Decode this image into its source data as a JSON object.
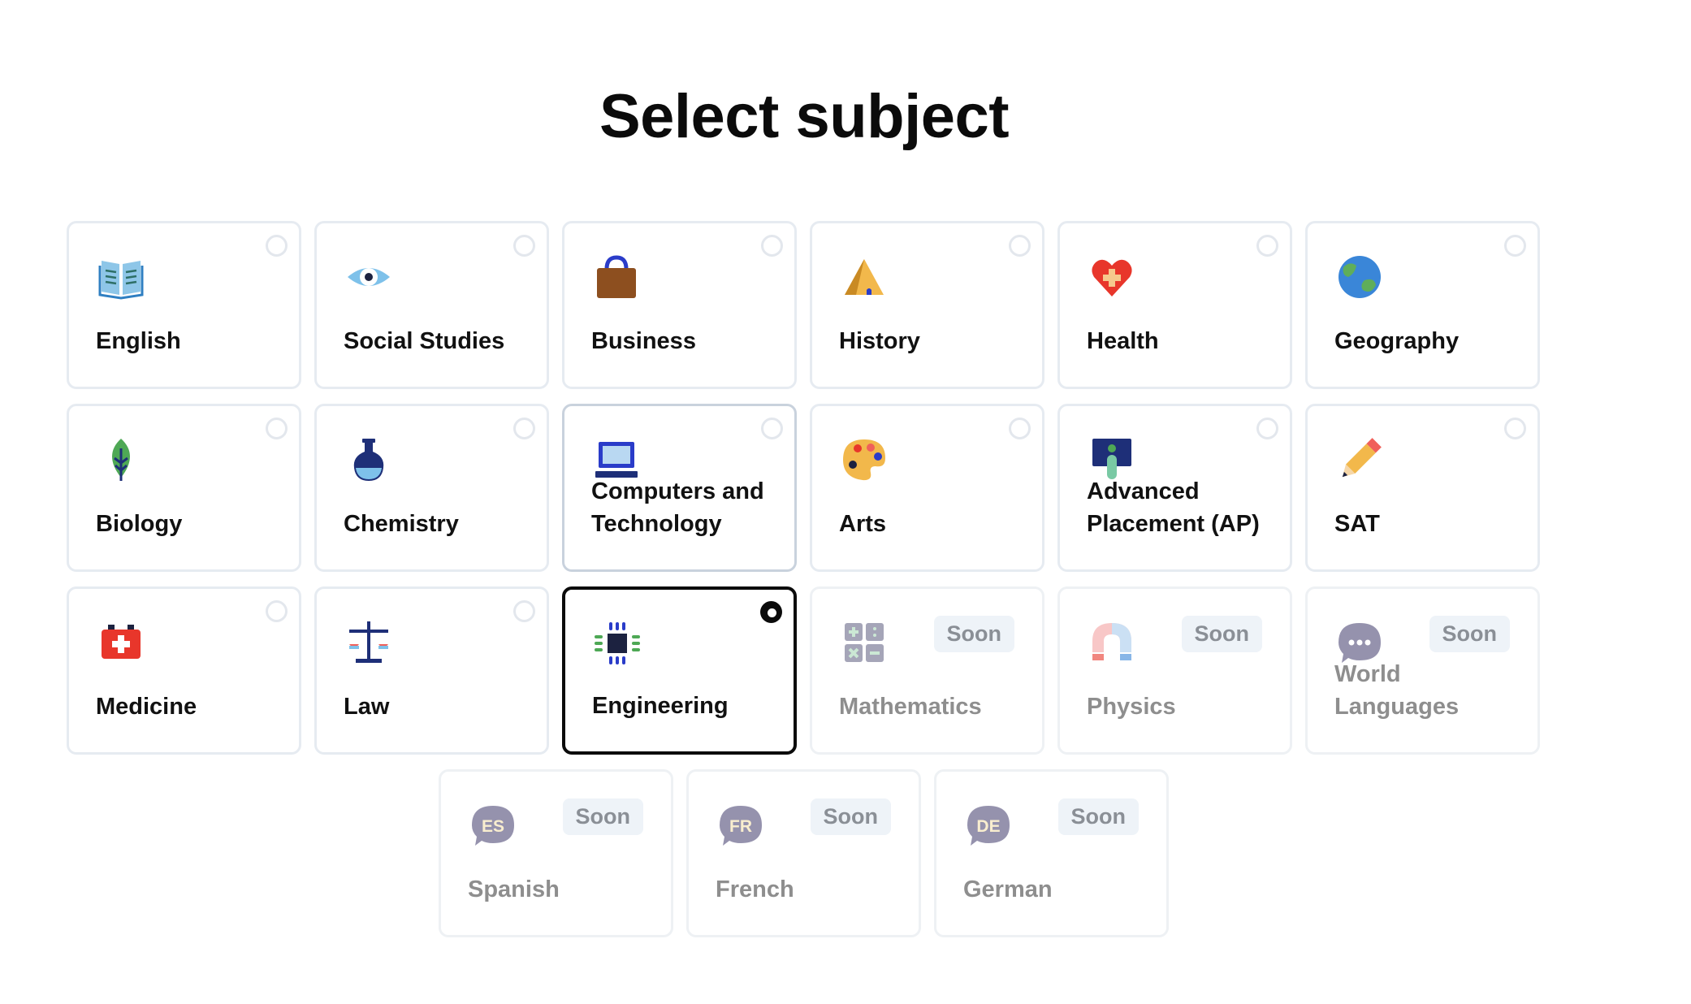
{
  "page": {
    "title": "Select subject"
  },
  "subjects": [
    {
      "label": "English",
      "icon": "open-book-icon"
    },
    {
      "label": "Social Studies",
      "icon": "eye-icon"
    },
    {
      "label": "Business",
      "icon": "briefcase-icon"
    },
    {
      "label": "History",
      "icon": "pyramid-icon"
    },
    {
      "label": "Health",
      "icon": "heart-plus-icon"
    },
    {
      "label": "Geography",
      "icon": "globe-icon"
    },
    {
      "label": "Biology",
      "icon": "leaf-icon"
    },
    {
      "label": "Chemistry",
      "icon": "flask-icon"
    },
    {
      "label": "Computers and Technology",
      "icon": "laptop-icon"
    },
    {
      "label": "Arts",
      "icon": "palette-icon"
    },
    {
      "label": "Advanced Placement (AP)",
      "icon": "ap-board-icon"
    },
    {
      "label": "SAT",
      "icon": "pencil-icon"
    },
    {
      "label": "Medicine",
      "icon": "medical-kit-icon"
    },
    {
      "label": "Law",
      "icon": "scales-icon"
    },
    {
      "label": "Engineering",
      "icon": "microchip-icon",
      "selected": true
    },
    {
      "label": "Mathematics",
      "icon": "calculator-icon",
      "badge": "Soon"
    },
    {
      "label": "Physics",
      "icon": "magnet-icon",
      "badge": "Soon"
    },
    {
      "label": "World Languages",
      "icon": "speech-bubble-icon",
      "badge": "Soon"
    },
    {
      "label": "Spanish",
      "icon": "speech-bubble-es-icon",
      "badge": "Soon",
      "bubble_text": "ES"
    },
    {
      "label": "French",
      "icon": "speech-bubble-fr-icon",
      "badge": "Soon",
      "bubble_text": "FR"
    },
    {
      "label": "German",
      "icon": "speech-bubble-de-icon",
      "badge": "Soon",
      "bubble_text": "DE"
    }
  ]
}
